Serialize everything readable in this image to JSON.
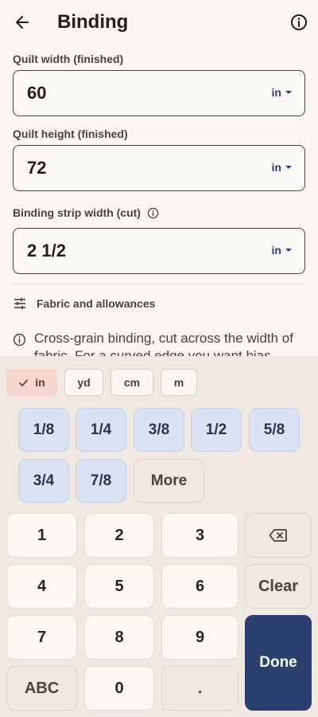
{
  "header": {
    "title": "Binding"
  },
  "fields": [
    {
      "label": "Quilt width (finished)",
      "value": "60",
      "unit": "in"
    },
    {
      "label": "Quilt height (finished)",
      "value": "72",
      "unit": "in"
    },
    {
      "label": "Binding strip width (cut)",
      "value": "2 1/2",
      "unit": "in"
    }
  ],
  "fabric": {
    "label": "Fabric and allowances"
  },
  "note": {
    "text": "Cross-grain binding, cut across the width of fabric. For a curved edge you want bias"
  },
  "keyboard": {
    "units": [
      "in",
      "yd",
      "cm",
      "m"
    ],
    "selected_unit": "in",
    "fractions": [
      "1/8",
      "1/4",
      "3/8",
      "1/2",
      "5/8",
      "3/4",
      "7/8"
    ],
    "more_label": "More",
    "digits": [
      "1",
      "2",
      "3",
      "4",
      "5",
      "6",
      "7",
      "8",
      "9",
      "0"
    ],
    "clear_label": "Clear",
    "abc_label": "ABC",
    "dot_label": ".",
    "done_label": "Done"
  },
  "colors": {
    "accent": "#2a3f6e",
    "selected_chip": "#f6d6cf",
    "fraction_key": "#dbe2f4",
    "background": "#f9f6f1"
  },
  "icons": {
    "back": "arrow-left-icon",
    "info": "info-icon",
    "tune": "sliders-icon",
    "check": "check-icon",
    "backspace": "backspace-icon"
  }
}
